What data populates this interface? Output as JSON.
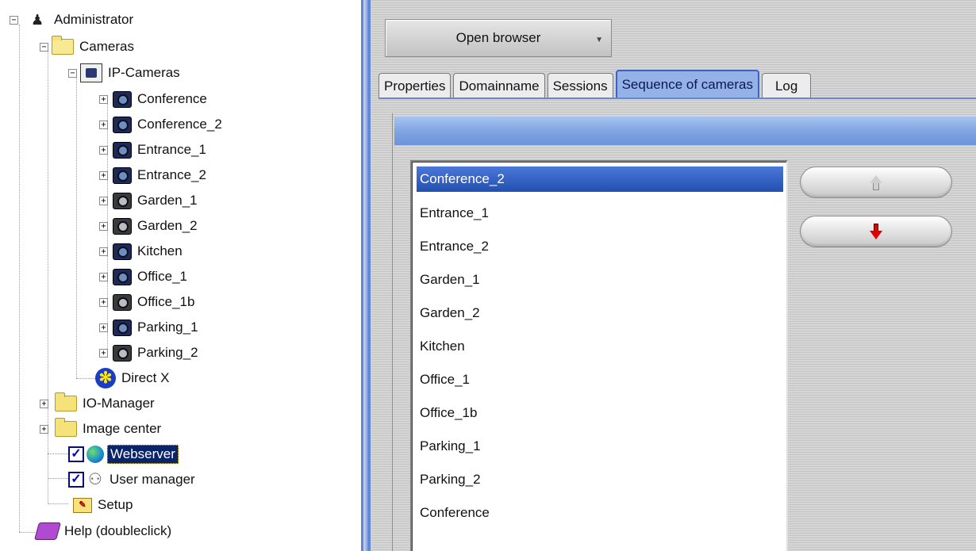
{
  "tree": {
    "root": "Administrator",
    "cameras_folder": "Cameras",
    "ip_cameras": "IP-Cameras",
    "camera_items": [
      {
        "label": "Conference"
      },
      {
        "label": "Conference_2"
      },
      {
        "label": "Entrance_1"
      },
      {
        "label": "Entrance_2"
      },
      {
        "label": "Garden_1"
      },
      {
        "label": "Garden_2"
      },
      {
        "label": "Kitchen"
      },
      {
        "label": "Office_1"
      },
      {
        "label": "Office_1b"
      },
      {
        "label": "Parking_1"
      },
      {
        "label": "Parking_2"
      }
    ],
    "direct_x": "Direct X",
    "io_manager": "IO-Manager",
    "image_center": "Image center",
    "webserver": "Webserver",
    "user_manager": "User manager",
    "setup": "Setup",
    "help": "Help (doubleclick)",
    "expand_symbol": "+",
    "collapse_symbol": "−",
    "check_mark": "✓"
  },
  "toolbar": {
    "open_browser": "Open browser"
  },
  "tabs": [
    {
      "label": "Properties"
    },
    {
      "label": "Domainname"
    },
    {
      "label": "Sessions"
    },
    {
      "label": "Sequence of cameras"
    },
    {
      "label": "Log"
    }
  ],
  "active_tab": "Sequence of cameras",
  "sequence": [
    "Conference_2",
    "Entrance_1",
    "Entrance_2",
    "Garden_1",
    "Garden_2",
    "Kitchen",
    "Office_1",
    "Office_1b",
    "Parking_1",
    "Parking_2",
    "Conference"
  ],
  "selected_sequence_item": "Conference_2",
  "colors": {
    "selection": "#0a246a",
    "active_tab": "#94b2e8",
    "list_selection": "#2f5cc0",
    "down_arrow": "#e00000"
  }
}
